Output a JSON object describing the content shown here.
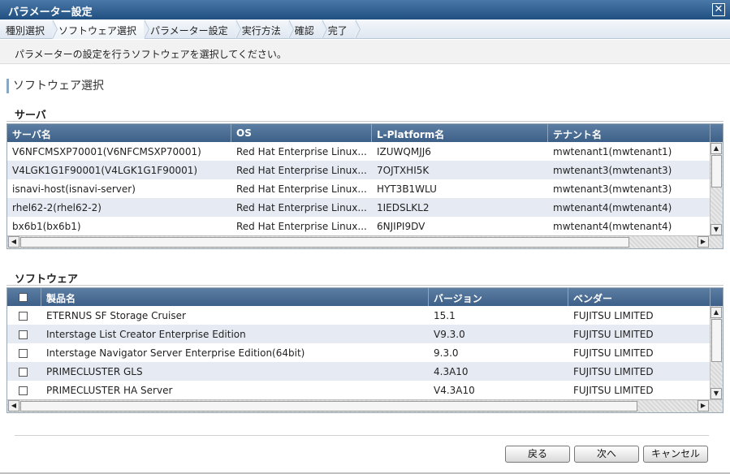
{
  "window": {
    "title": "パラメーター設定",
    "close_symbol": "✕"
  },
  "wizard": {
    "steps": [
      {
        "label": "種別選択"
      },
      {
        "label": "ソフトウェア選択"
      },
      {
        "label": "パラメーター設定"
      },
      {
        "label": "実行方法"
      },
      {
        "label": "確認"
      },
      {
        "label": "完了"
      }
    ],
    "active_index": 1
  },
  "instruction": "パラメーターの設定を行うソフトウェアを選択してください。",
  "section_title": "ソフトウェア選択",
  "server": {
    "group_title": "サーバ",
    "columns": [
      "サーバ名",
      "OS",
      "L-Platform名",
      "テナント名"
    ],
    "rows": [
      [
        "V6NFCMSXP70001(V6NFCMSXP70001)",
        "Red Hat Enterprise Linux...",
        "IZUWQMJJ6",
        "mwtenant1(mwtenant1)"
      ],
      [
        "V4LGK1G1F90001(V4LGK1G1F90001)",
        "Red Hat Enterprise Linux...",
        "7OJTXHI5K",
        "mwtenant3(mwtenant3)"
      ],
      [
        "isnavi-host(isnavi-server)",
        "Red Hat Enterprise Linux...",
        "HYT3B1WLU",
        "mwtenant3(mwtenant3)"
      ],
      [
        "rhel62-2(rhel62-2)",
        "Red Hat Enterprise Linux...",
        "1IEDSLKL2",
        "mwtenant4(mwtenant4)"
      ],
      [
        "bx6b1(bx6b1)",
        "Red Hat Enterprise Linux...",
        "6NJIPI9DV",
        "mwtenant4(mwtenant4)"
      ]
    ]
  },
  "software": {
    "group_title": "ソフトウェア",
    "columns": [
      "製品名",
      "バージョン",
      "ベンダー"
    ],
    "rows": [
      [
        "ETERNUS SF Storage Cruiser",
        "15.1",
        "FUJITSU LIMITED"
      ],
      [
        "Interstage List Creator Enterprise Edition",
        "V9.3.0",
        "FUJITSU LIMITED"
      ],
      [
        "Interstage Navigator Server Enterprise Edition(64bit)",
        "9.3.0",
        "FUJITSU LIMITED"
      ],
      [
        "PRIMECLUSTER GLS",
        "4.3A10",
        "FUJITSU LIMITED"
      ],
      [
        "PRIMECLUSTER HA Server",
        "V4.3A10",
        "FUJITSU LIMITED"
      ]
    ]
  },
  "buttons": {
    "back": "戻る",
    "next": "次へ",
    "cancel": "キャンセル"
  },
  "scroll_arrows": {
    "up": "▲",
    "down": "▼",
    "left": "◀",
    "right": "▶"
  }
}
